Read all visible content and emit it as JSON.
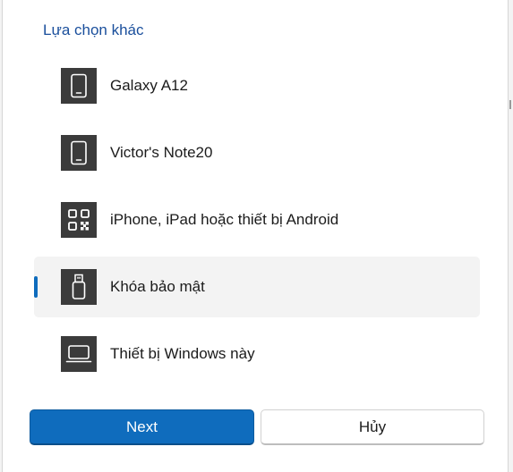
{
  "section_title": "Lựa chọn khác",
  "options": [
    {
      "label": "Galaxy A12",
      "icon": "phone-icon",
      "selected": false
    },
    {
      "label": "Victor's Note20",
      "icon": "phone-icon",
      "selected": false
    },
    {
      "label": "iPhone, iPad hoặc thiết bị Android",
      "icon": "qr-code-icon",
      "selected": false
    },
    {
      "label": "Khóa bảo mật",
      "icon": "usb-key-icon",
      "selected": true
    },
    {
      "label": "Thiết bị Windows này",
      "icon": "laptop-icon",
      "selected": false
    }
  ],
  "buttons": {
    "next_label": "Next",
    "cancel_label": "Hủy"
  },
  "colors": {
    "accent": "#0f6cbd",
    "title": "#1a4f9c",
    "icon_tile": "#3b3b3b",
    "selected_bg": "#f3f3f3"
  }
}
